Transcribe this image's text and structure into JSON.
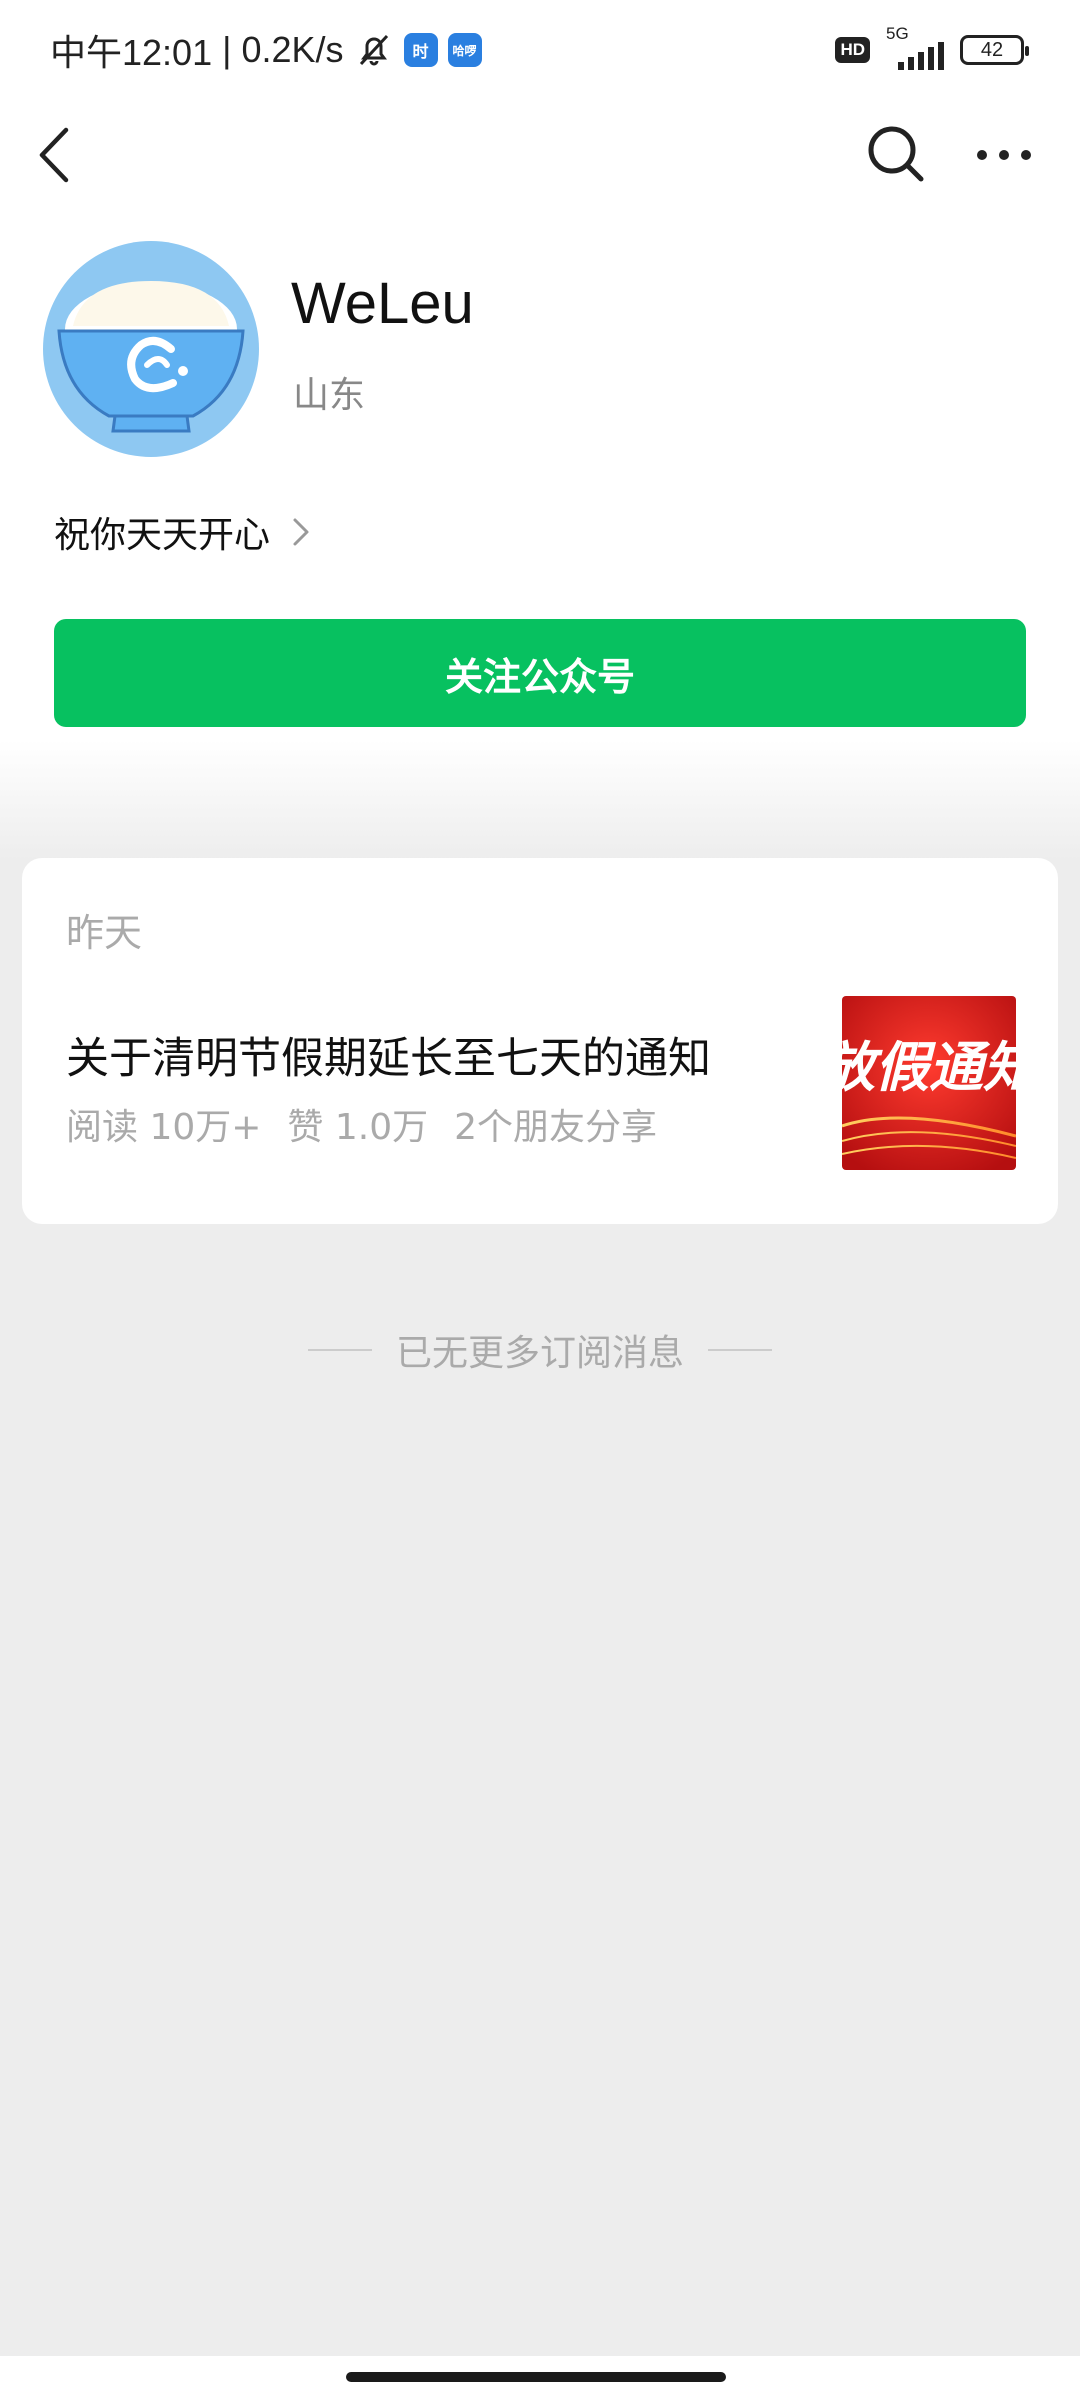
{
  "status_bar": {
    "time": "中午12:01",
    "speed": "| 0.2K/s",
    "app_icon_1": "时",
    "app_icon_2": "哈啰",
    "hd_label": "HD",
    "network": "5G",
    "battery": "42"
  },
  "profile": {
    "name": "WeLeu",
    "region": "山东",
    "signature": "祝你天天开心",
    "follow_button_label": "关注公众号"
  },
  "article_group": {
    "date": "昨天",
    "article": {
      "title": "关于清明节假期延长至七天的通知",
      "reads": "阅读 10万+",
      "likes": "赞 1.0万",
      "shares": "2个朋友分享",
      "thumbnail_text": "放假通知"
    }
  },
  "footer": {
    "end_message": "已无更多订阅消息"
  },
  "colors": {
    "accent_green": "#07c160",
    "thumbnail_red": "#d21f1f"
  }
}
